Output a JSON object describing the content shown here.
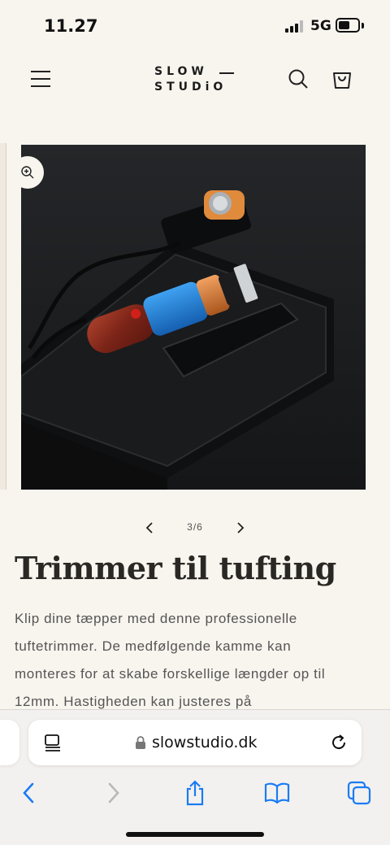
{
  "status_bar": {
    "time": "11.27",
    "network": "5G"
  },
  "header": {
    "logo_line1": "SLOW",
    "logo_line2": "STUDiO",
    "icons": [
      "menu-icon",
      "search-icon",
      "cart-icon"
    ]
  },
  "gallery": {
    "pager_text": "3/6",
    "icons": [
      "zoom-icon",
      "chevron-left-icon",
      "chevron-right-icon"
    ]
  },
  "product": {
    "title": "Trimmer til tufting",
    "description_lines": [
      "Klip dine tæpper med denne professionelle",
      "tuftetrimmer. De medfølgende kamme kan",
      "monteres for at skabe forskellige længder op til",
      "12mm. Hastigheden kan justeres på"
    ]
  },
  "browser": {
    "url": "slowstudio.dk",
    "icons": [
      "reader-icon",
      "lock-icon",
      "reload-icon",
      "back-icon",
      "forward-icon",
      "share-icon",
      "bookmarks-icon",
      "tabs-icon"
    ]
  },
  "colors": {
    "page_background": "#f8f4ee",
    "text": "#2a2824",
    "trimmer_blue": "#1f7fd6",
    "trimmer_wood": "#8a2a1e",
    "trimmer_copper": "#d07a33",
    "safari_blue": "#1a7cf4"
  }
}
